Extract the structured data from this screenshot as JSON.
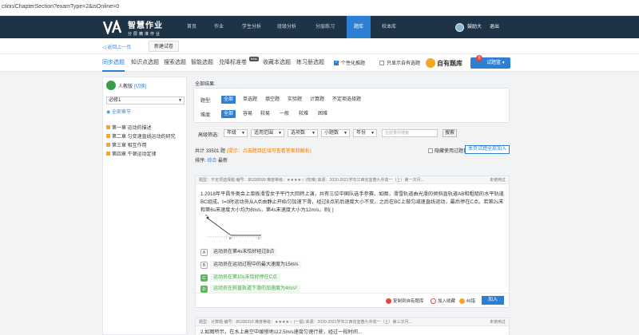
{
  "browser": {
    "url": "ction/ChapterSection?examType=2&isOnline=0"
  },
  "brand": {
    "title": "智慧作业",
    "subtitle": "分层精准作业"
  },
  "nav": {
    "items": [
      "首页",
      "作业",
      "学生分析",
      "班级分析",
      "分层练习",
      "题库",
      "校本库"
    ],
    "active": "题库",
    "user": "鼓励大",
    "logout": "退出"
  },
  "subbar": {
    "back": "返回上一页",
    "crumb": "新建试卷"
  },
  "tabs": {
    "items": [
      "同步选题",
      "知识点选题",
      "搜索选题",
      "智能选题",
      "兑降标准卷",
      "收藏本选题",
      "练习册选题"
    ],
    "active": "同步选题",
    "new_badge": "beta",
    "personal_push": "个性化推题",
    "own_only": "只显示自有选题",
    "my_bank": "自有题库",
    "cart": "试题篮",
    "cart_count": "0"
  },
  "sidebar": {
    "textbook": "人教版",
    "switch": "[切换]",
    "book": "必修1",
    "all_chapters": "全部章节",
    "chapters": [
      "第一章  运动的描述",
      "第二章  匀变速直线运动的研究",
      "第三章  相互作用",
      "第四章  牛顿运动定律"
    ]
  },
  "filters": {
    "all_results": "全部结果:",
    "type_label": "题型:",
    "types": [
      "全部",
      "单选题",
      "填空题",
      "实验题",
      "计算题",
      "不定项选择题"
    ],
    "diff_label": "难度:",
    "diffs": [
      "全部",
      "容易",
      "较易",
      "一般",
      "较难",
      "困难"
    ],
    "advanced_label": "高级筛选:",
    "dropdowns": [
      "年级",
      "适用范围",
      "选项数",
      "小题数",
      "年份"
    ],
    "search_placeholder": "在结果中搜索",
    "search_button": "搜索"
  },
  "results": {
    "count_prefix": "共计",
    "count": "33501",
    "count_suffix": "题",
    "tip": "(提示：点击题目区域可查看答案和解析)",
    "hide_used": "隐藏使用过题目",
    "add_page": "本页试题全部加入",
    "sort_label": "排序:",
    "sort_options": [
      "综合",
      "最新"
    ]
  },
  "question": {
    "meta": "题型：不定项选择题    编号：85330599    难度等级：★★★★☆    (较难)    来源：2020-2021学年江西省宜春九中高一（上）第一次月...",
    "used": "未使用过",
    "text": "1.2018年平昌冬奥会上单板滑雪女子平行大回转上演，共有三位中国队选手参赛。如图，滑雪轨道由光滑的倾斜直轨道AB和粗糙的水平轨道BC组成。t=0时运动员从A点由静止开始匀加速下滑，经过B点前后速度大小不变，之后在BC上做匀减速直线运动，最后停在C点。若第2s末和第6s末速度大小均为8m/s，第4s末速度大小为12m/s，则(      )",
    "fig_a": "A",
    "fig_b": "B",
    "fig_c": "C",
    "options": [
      {
        "letter": "A",
        "text": "运动员在第4s末恰好经过B点",
        "correct": false
      },
      {
        "letter": "B",
        "text": "运动员在运动过程中的最大速度为15m/s",
        "correct": false
      },
      {
        "letter": "C",
        "text": "运动员在第10s末恰好停在C点",
        "correct": true
      },
      {
        "letter": "D",
        "text": "运动员在斜直轨道下滑的加速度为4m/s²",
        "correct": true
      }
    ],
    "actions": {
      "copy": "复制到自有题库",
      "collect": "加入收藏",
      "report": "纠错",
      "add": "加入"
    }
  },
  "question2": {
    "meta": "题型：计算题    编号：85330316    难度等级：★★★★☆    (一般)    来源：2020-2021学年江西省宜春九中高一（上）第三次月...",
    "used": "未使用过",
    "text": "2.如图所示，在水上高空中缓慢地以2.5m/s速度匀速行驶，经过一段时间...",
    "colors": {}
  },
  "colors": {
    "nav_bg": "#1e3345",
    "accent": "#2d7fd3",
    "correct": "#5bb85d",
    "tip": "#f57c00"
  }
}
